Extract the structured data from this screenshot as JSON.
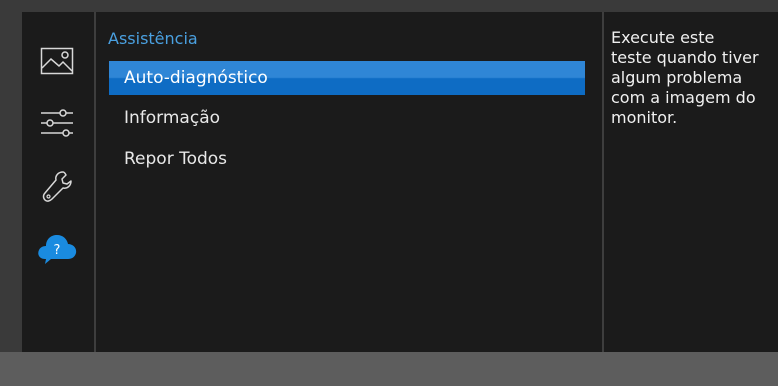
{
  "colors": {
    "accent": "#4aa0e0",
    "selection": "#1a74c9",
    "panel": "#1b1b1b",
    "bottom_bar": "#5d5d5d"
  },
  "sidebar": {
    "items": [
      {
        "name": "picture-icon",
        "active": false
      },
      {
        "name": "adjust-sliders-icon",
        "active": false
      },
      {
        "name": "wrench-icon",
        "active": false
      },
      {
        "name": "help-cloud-icon",
        "active": true,
        "label": "?"
      }
    ]
  },
  "menu": {
    "title": "Assistência",
    "items": [
      {
        "label": "Auto-diagnóstico",
        "selected": true
      },
      {
        "label": "Informação",
        "selected": false
      },
      {
        "label": "Repor Todos",
        "selected": false
      }
    ]
  },
  "description": {
    "lines": [
      "Execute este",
      "teste quando tiver",
      "algum problema",
      "com a imagem do",
      "monitor."
    ]
  }
}
